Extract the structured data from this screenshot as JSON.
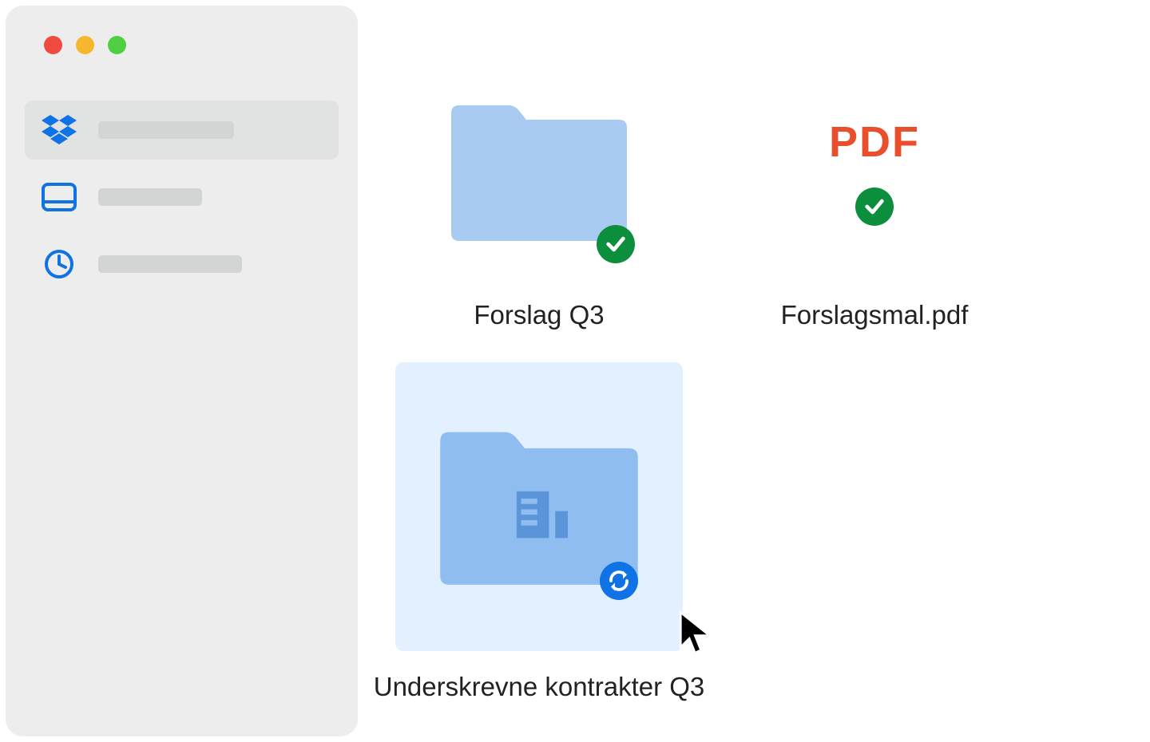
{
  "items": {
    "folder1": {
      "label": "Forslag Q3"
    },
    "file1": {
      "label": "Forslagsmal.pdf",
      "type_label": "PDF"
    },
    "folder2": {
      "label": "Underskrevne kontrakter Q3"
    }
  }
}
